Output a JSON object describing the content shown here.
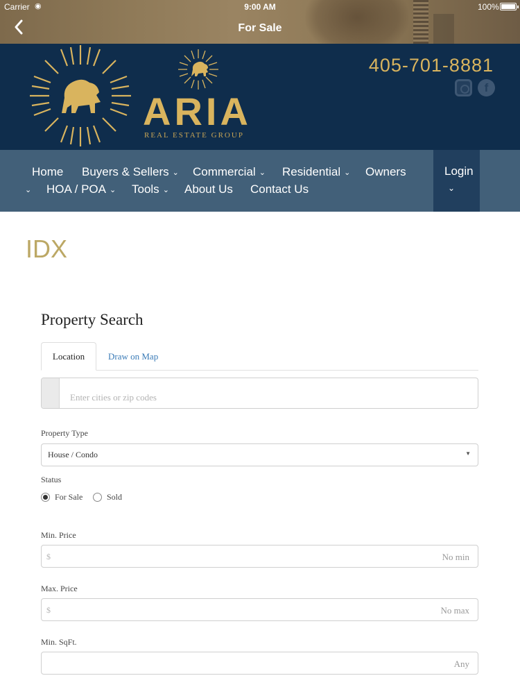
{
  "status_bar": {
    "carrier": "Carrier",
    "time": "9:00 AM",
    "battery": "100%"
  },
  "nav_bar": {
    "back_icon": "chevron-left-icon",
    "title": "For Sale"
  },
  "header": {
    "brand_name": "ARIA",
    "brand_sub": "REAL ESTATE GROUP",
    "phone": "405-701-8881",
    "colors": {
      "navy": "#0f2d4c",
      "gold": "#d9b45e"
    },
    "social_icons": [
      "instagram-icon",
      "facebook-icon"
    ]
  },
  "main_nav": {
    "items": [
      {
        "label": "Home"
      },
      {
        "label": "Buyers & Sellers",
        "dropdown": true
      },
      {
        "label": "Commercial",
        "dropdown": true
      },
      {
        "label": "Residential",
        "dropdown": true
      },
      {
        "label": "Owners",
        "dropdown": true
      },
      {
        "label": "HOA / POA",
        "dropdown": true
      },
      {
        "label": "Tools",
        "dropdown": true
      },
      {
        "label": "About Us"
      },
      {
        "label": "Contact Us"
      }
    ],
    "login_label": "Login",
    "colors": {
      "bar": "#426079",
      "login": "#213f5e"
    }
  },
  "page": {
    "title": "IDX",
    "search": {
      "heading": "Property Search",
      "tabs": [
        {
          "label": "Location",
          "active": true
        },
        {
          "label": "Draw on Map",
          "active": false
        }
      ],
      "location_placeholder": "Enter cities or zip codes",
      "property_type": {
        "label": "Property Type",
        "value": "House / Condo"
      },
      "status": {
        "label": "Status",
        "options": [
          {
            "label": "For Sale",
            "checked": true
          },
          {
            "label": "Sold",
            "checked": false
          }
        ]
      },
      "min_price": {
        "label": "Min. Price",
        "prefix": "$",
        "placeholder": "No min"
      },
      "max_price": {
        "label": "Max. Price",
        "prefix": "$",
        "placeholder": "No max"
      },
      "min_sqft": {
        "label": "Min. SqFt.",
        "placeholder": "Any"
      }
    }
  }
}
